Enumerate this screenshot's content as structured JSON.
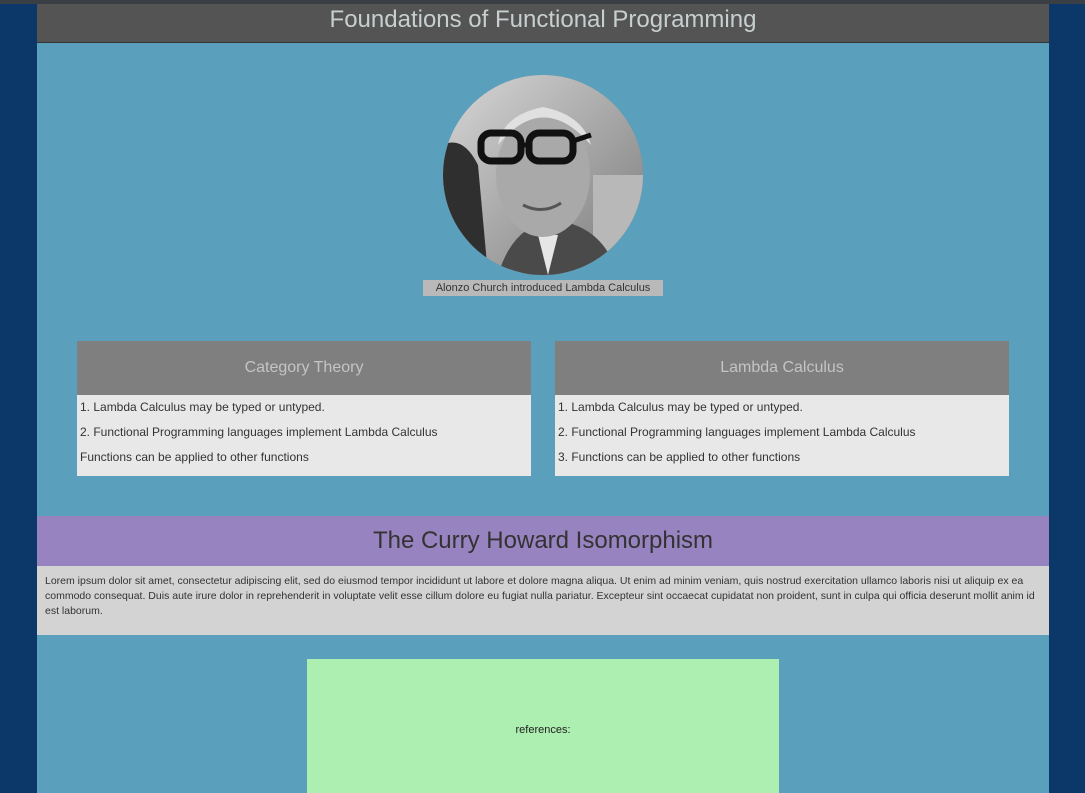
{
  "header": {
    "title": "Foundations of Functional Programming"
  },
  "portrait": {
    "caption": "Alonzo Church introduced Lambda Calculus"
  },
  "cards": [
    {
      "title": "Category Theory",
      "items": [
        "1. Lambda Calculus may be typed or untyped.",
        "2. Functional Programming languages implement Lambda Calculus",
        "Functions can be applied to other functions"
      ]
    },
    {
      "title": "Lambda Calculus",
      "items": [
        "1. Lambda Calculus may be typed or untyped.",
        "2. Functional Programming languages implement Lambda Calculus",
        "3. Functions can be applied to other functions"
      ]
    }
  ],
  "curry": {
    "title": "The Curry Howard Isomorphism",
    "body": "Lorem ipsum dolor sit amet, consectetur adipiscing elit, sed do eiusmod tempor incididunt ut labore et dolore magna aliqua. Ut enim ad minim veniam, quis nostrud exercitation ullamco laboris nisi ut aliquip ex ea commodo consequat. Duis aute irure dolor in reprehenderit in voluptate velit esse cillum dolore eu fugiat nulla pariatur. Excepteur sint occaecat cupidatat non proident, sunt in culpa qui officia deserunt mollit anim id est laborum."
  },
  "references": {
    "label": "references:"
  }
}
